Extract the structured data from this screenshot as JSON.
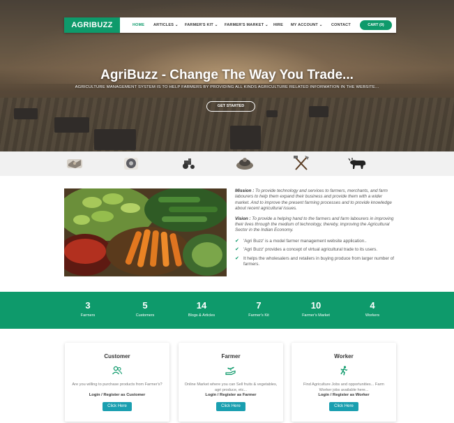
{
  "nav": {
    "logo": "AGRIBUZZ",
    "items": [
      "HOME",
      "ARTICLES ⌄",
      "FARMER'S KIT ⌄",
      "FARMER'S MARKET ⌄",
      "HIRE",
      "MY ACCOUNT ⌄",
      "CONTACT"
    ],
    "cart": "CART (0)"
  },
  "hero": {
    "title": "AgriBuzz - Change The Way You Trade...",
    "subtitle": "AGRICULTURE MANAGEMENT SYSTEM IS TO HELP FARMERS BY PROVIDING ALL KINDS AGRICULTURE RELATED INFORMATION IN THE WEBSITE...",
    "button": "GET STARTED"
  },
  "icons": [
    "handshake-icon",
    "seed-bag-icon",
    "tractor-icon",
    "harvest-icon",
    "tools-icon",
    "bull-plough-icon"
  ],
  "mission": {
    "mission_label": "Mission :",
    "mission_text": " To provide technology and services to farmers, merchants, and farm labourers to help them expand their business and provide them with a wider market. And to improve the present farming processes and to provide knowledge about recent agricultural issues.",
    "vision_label": "Vision :",
    "vision_text": " To provide a helping hand to the farmers and farm labourers in improving their lives through the medium of technology, thereby, improving the Agricultural Sector in the Indian Economy.",
    "bullets": [
      "'Agri Buzz' is a model farmer management website application..",
      "'Agri Buzz' provides a concept of virtual agricultural trade to its users.",
      "It helps the wholesalers and retailers in buying produce from larger number of farmers."
    ]
  },
  "stats": [
    {
      "num": "3",
      "label": "Farmers"
    },
    {
      "num": "5",
      "label": "Customers"
    },
    {
      "num": "14",
      "label": "Blogs & Articles"
    },
    {
      "num": "7",
      "label": "Farmer's Kit"
    },
    {
      "num": "10",
      "label": "Farmer's Market"
    },
    {
      "num": "4",
      "label": "Workers"
    }
  ],
  "cards": [
    {
      "title": "Customer",
      "desc": "Are you willing to purchase products from Farmer's?",
      "login": "Login / Register as Customer",
      "button": "Click Here"
    },
    {
      "title": "Farmer",
      "desc": "Online Market where you can Sell fruits & vegetables, agri produce, etc...",
      "login": "Login / Register as Farmer",
      "button": "Click Here"
    },
    {
      "title": "Worker",
      "desc": "Find Agriculture Jobs and opportunities... Farm Worker jobs available here...",
      "login": "Login / Register as Worker",
      "button": "Click Here"
    }
  ],
  "colors": {
    "brand": "#0e9a6b",
    "button": "#1a9fb0"
  }
}
